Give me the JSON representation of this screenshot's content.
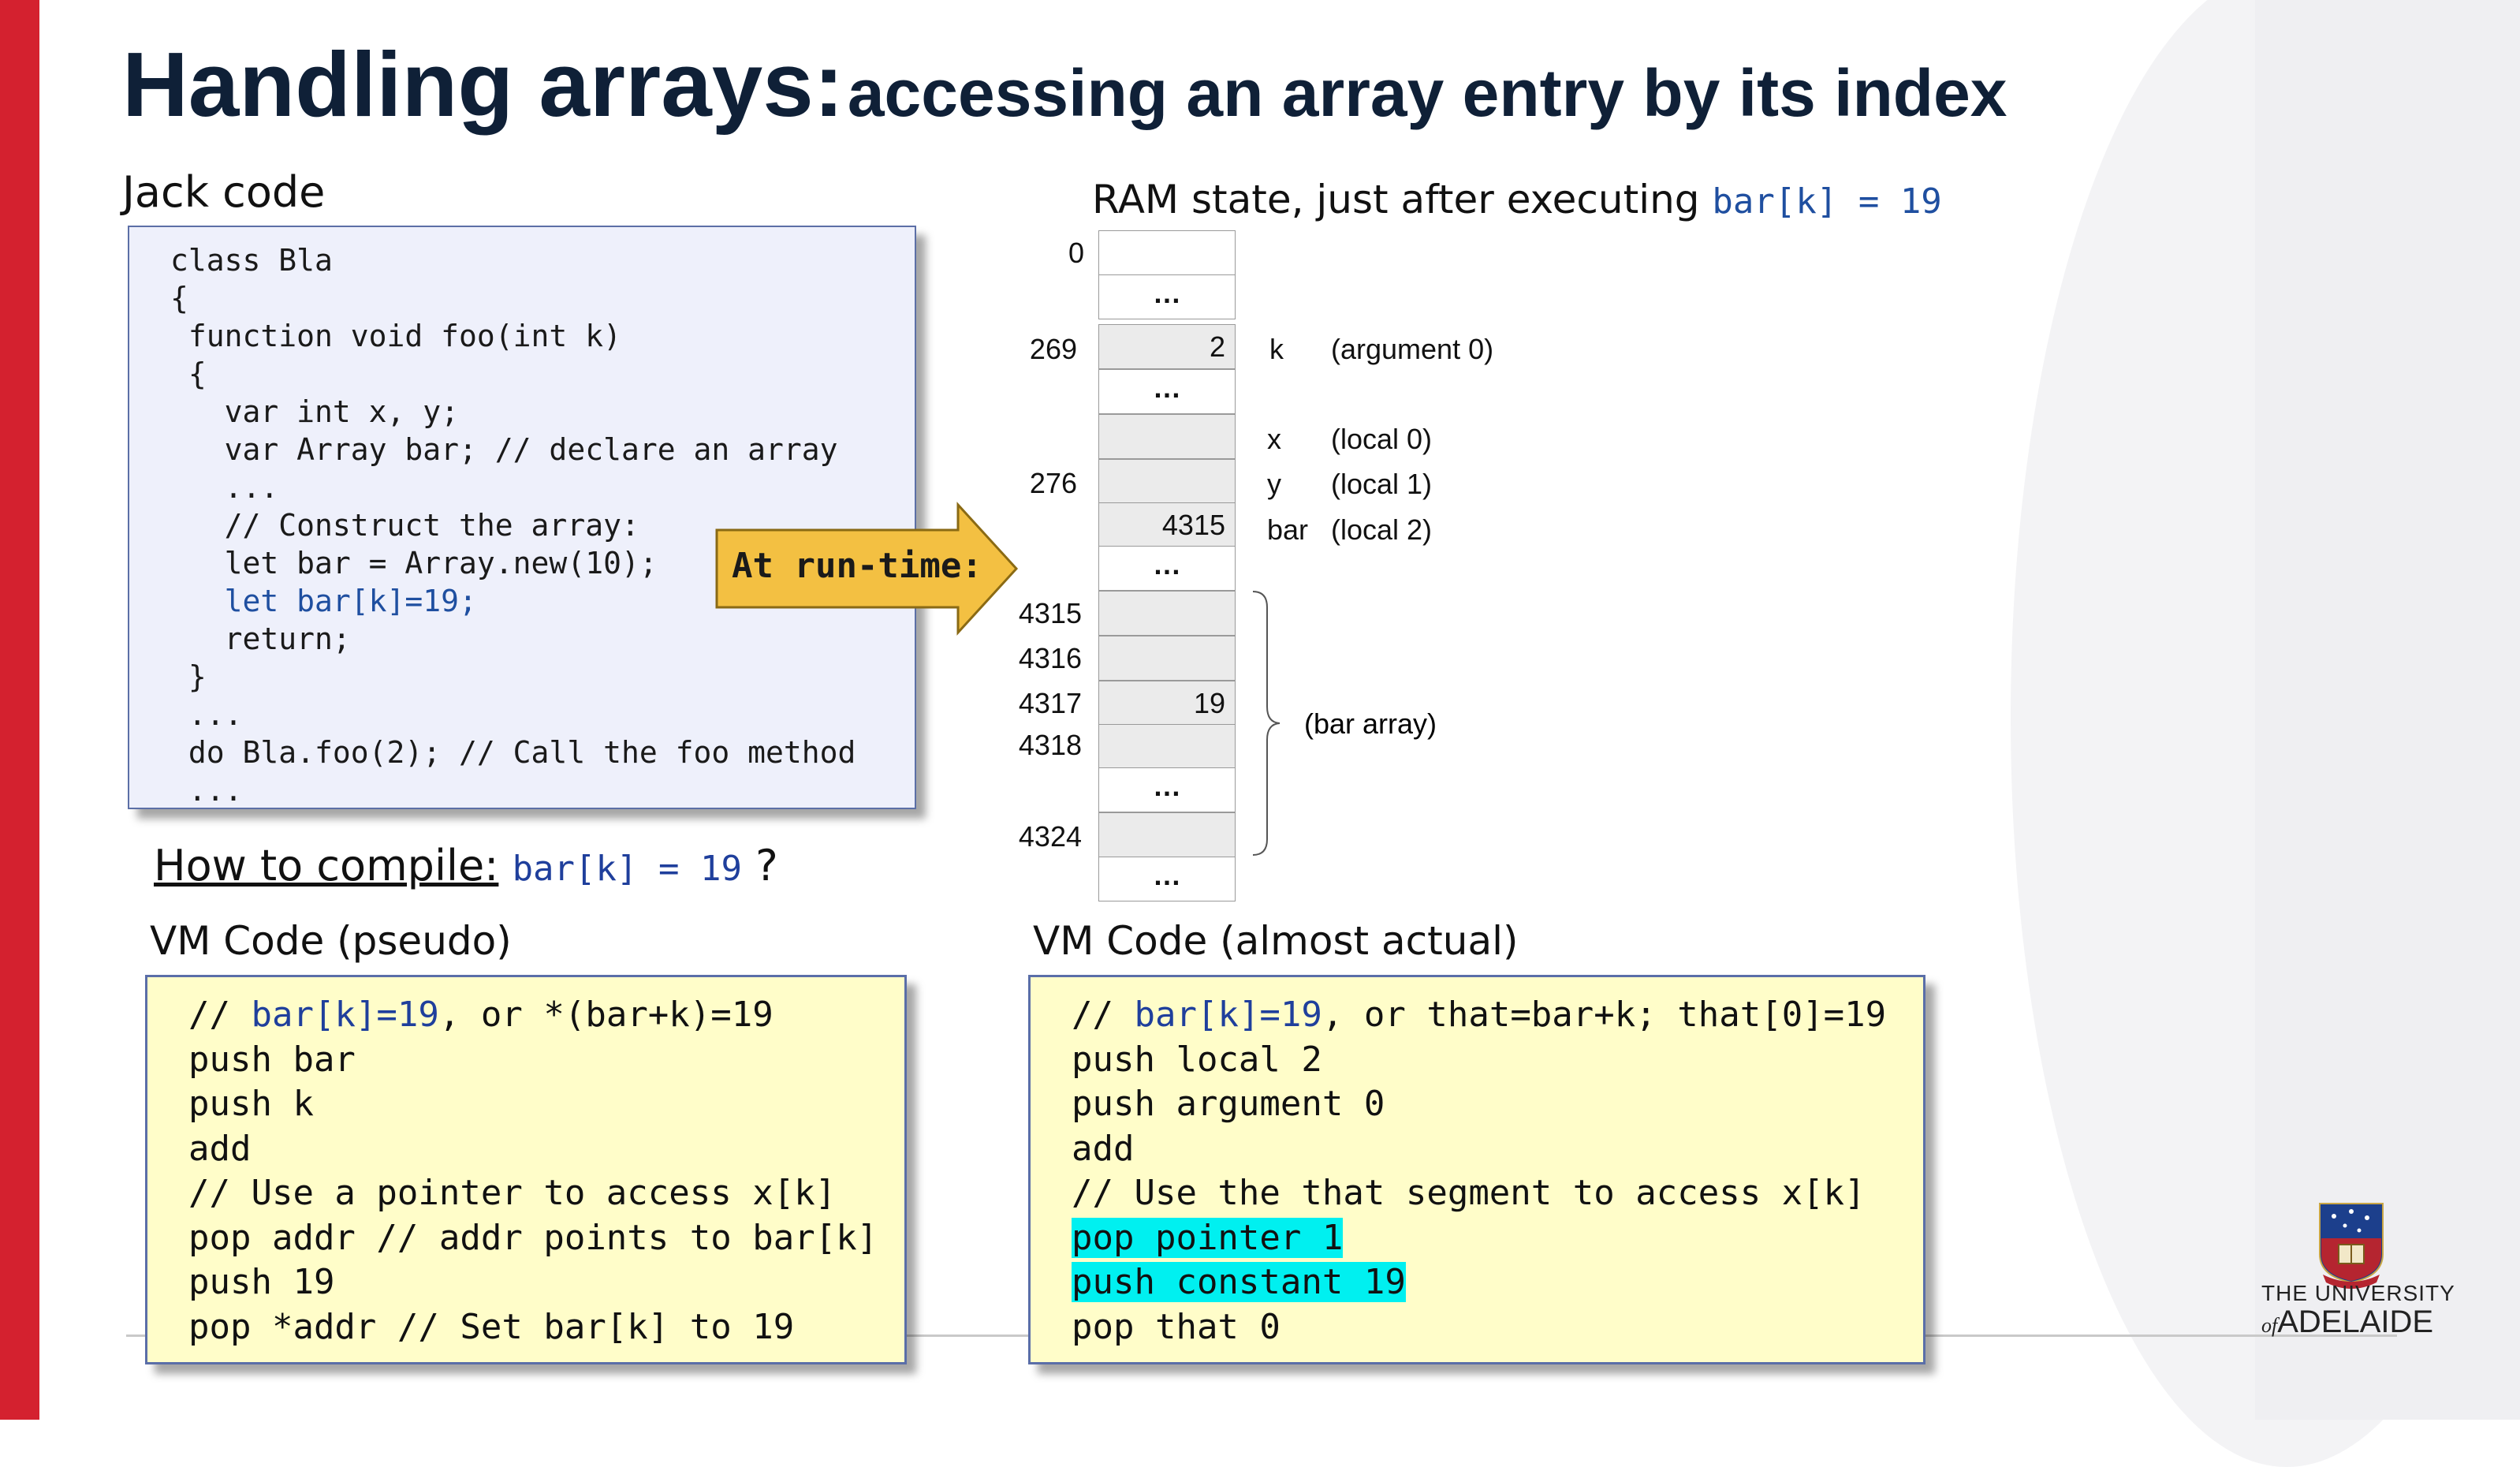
{
  "title": {
    "main": "Handling arrays:",
    "sub": "accessing an array entry by its index"
  },
  "jack": {
    "label": "Jack code",
    "lines": [
      "class Bla",
      "{",
      " function void foo(int k)",
      " {",
      "   var int x, y;",
      "   var Array bar; // declare an array",
      "   ...",
      "   // Construct the array:",
      "   let bar = Array.new(10);",
      "   let bar[k]=19;",
      "   return;",
      " }",
      " ...",
      " do Bla.foo(2); // Call the foo method",
      " ..."
    ],
    "highlight_line": "   let bar[k]=19;"
  },
  "arrow_label": "At run-time:",
  "ram": {
    "label_text": "RAM state, just after executing ",
    "label_code": "bar[k] = 19",
    "dots": "…",
    "addresses": [
      "0",
      "269",
      "276",
      "4315",
      "4316",
      "4317",
      "4318",
      "4324"
    ],
    "cells": {
      "k_value": "2",
      "bar_value": "4315",
      "bar_k_value": "19"
    },
    "vars": [
      {
        "name": "k",
        "desc": "(argument 0)"
      },
      {
        "name": "x",
        "desc": "(local 0)"
      },
      {
        "name": "y",
        "desc": "(local 1)"
      },
      {
        "name": "bar",
        "desc": "(local 2)"
      }
    ],
    "brace_label": "(bar array)"
  },
  "how": {
    "text": "How to compile:",
    "code": "bar[k] = 19",
    "suffix": " ?"
  },
  "vm_pseudo": {
    "label": "VM Code (pseudo)",
    "comment_prefix": "// ",
    "comment_code": "bar[k]=19",
    "comment_rest": ", or *(bar+k)=19",
    "lines": [
      "push bar",
      "push k",
      "add",
      "// Use a pointer to access x[k]",
      "pop addr // addr points to bar[k]",
      "push 19",
      "pop *addr // Set bar[k] to 19"
    ]
  },
  "vm_actual": {
    "label": "VM Code (almost actual)",
    "comment_prefix": "// ",
    "comment_code": "bar[k]=19",
    "comment_rest": ", or that=bar+k; that[0]=19",
    "lines_before": [
      "push local 2",
      "push argument 0",
      "add",
      "// Use the that segment to access x[k]"
    ],
    "highlighted": [
      "pop pointer 1",
      "push constant 19"
    ],
    "last": "pop that 0",
    "highlight_color": "#00f0f0"
  },
  "logo": {
    "line1": "THE UNIVERSITY",
    "of": "of",
    "name": "ADELAIDE"
  },
  "colors": {
    "accent_red": "#d4212f",
    "title_navy": "#0f2037",
    "code_blue": "#1f3f9c",
    "jack_box_bg": "#eef0fb",
    "vm_box_bg": "#fffdc9",
    "arrow_fill": "#f3c042"
  }
}
